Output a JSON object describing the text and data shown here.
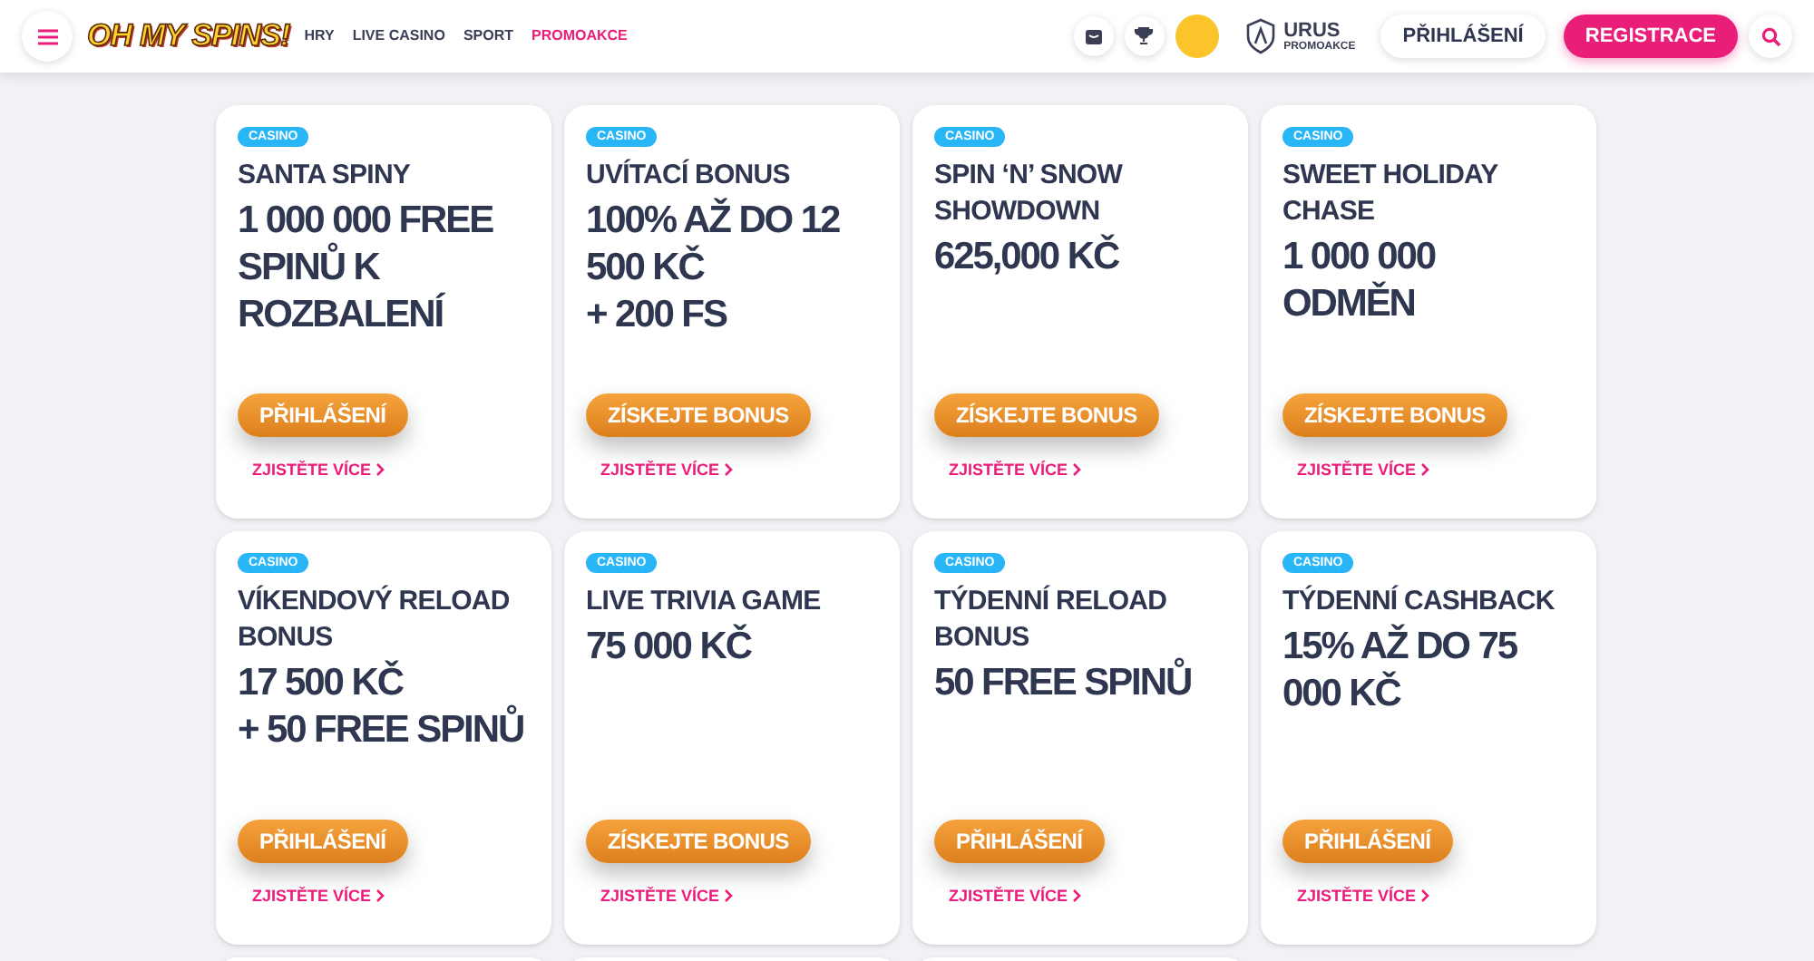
{
  "header": {
    "logo": "OH MY SPINS!",
    "nav": [
      {
        "label": "HRY",
        "selected": false
      },
      {
        "label": "LIVE CASINO",
        "selected": false
      },
      {
        "label": "SPORT",
        "selected": false
      },
      {
        "label": "PROMOAKCE",
        "selected": true
      }
    ],
    "account": {
      "name": "URUS",
      "subtitle": "PROMOAKCE"
    },
    "login": "PŘIHLÁŠENÍ",
    "register": "REGISTRACE"
  },
  "promotions": [
    {
      "kind": "full",
      "tag": "CASINO",
      "title": "SANTA SPINY",
      "value": "1 000 000 FREE SPINŮ K ROZBALENÍ",
      "action": "PŘIHLÁŠENÍ",
      "more": "ZJISTĚTE VÍCE"
    },
    {
      "kind": "full",
      "tag": "CASINO",
      "title": "UVÍTACÍ BONUS",
      "value": "100% AŽ DO 12 500 KČ\n+ 200 FS",
      "action": "ZÍSKEJTE BONUS",
      "more": "ZJISTĚTE VÍCE"
    },
    {
      "kind": "full",
      "tag": "CASINO",
      "title": "SPIN ‘N’ SNOW SHOWDOWN",
      "value": "625,000 KČ",
      "action": "ZÍSKEJTE BONUS",
      "more": "ZJISTĚTE VÍCE"
    },
    {
      "kind": "full",
      "tag": "CASINO",
      "title": "SWEET HOLIDAY CHASE",
      "value": "1 000 000 ODMĚN",
      "action": "ZÍSKEJTE BONUS",
      "more": "ZJISTĚTE VÍCE"
    },
    {
      "kind": "full",
      "tag": "CASINO",
      "title": "VÍKENDOVÝ RELOAD BONUS",
      "value": "17 500 KČ\n+ 50 FREE SPINŮ",
      "action": "PŘIHLÁŠENÍ",
      "more": "ZJISTĚTE VÍCE"
    },
    {
      "kind": "full",
      "tag": "CASINO",
      "title": "LIVE TRIVIA GAME",
      "value": "75 000 KČ",
      "action": "ZÍSKEJTE BONUS",
      "more": "ZJISTĚTE VÍCE"
    },
    {
      "kind": "full",
      "tag": "CASINO",
      "title": "TÝDENNÍ RELOAD BONUS",
      "value": "50 FREE SPINŮ",
      "action": "PŘIHLÁŠENÍ",
      "more": "ZJISTĚTE VÍCE"
    },
    {
      "kind": "full",
      "tag": "CASINO",
      "title": "TÝDENNÍ CASHBACK",
      "value": "15% AŽ DO 75 000 KČ",
      "action": "PŘIHLÁŠENÍ",
      "more": "ZJISTĚTE VÍCE"
    },
    {
      "kind": "cut_off"
    },
    {
      "kind": "cut_off"
    },
    {
      "kind": "cut_off"
    }
  ]
}
